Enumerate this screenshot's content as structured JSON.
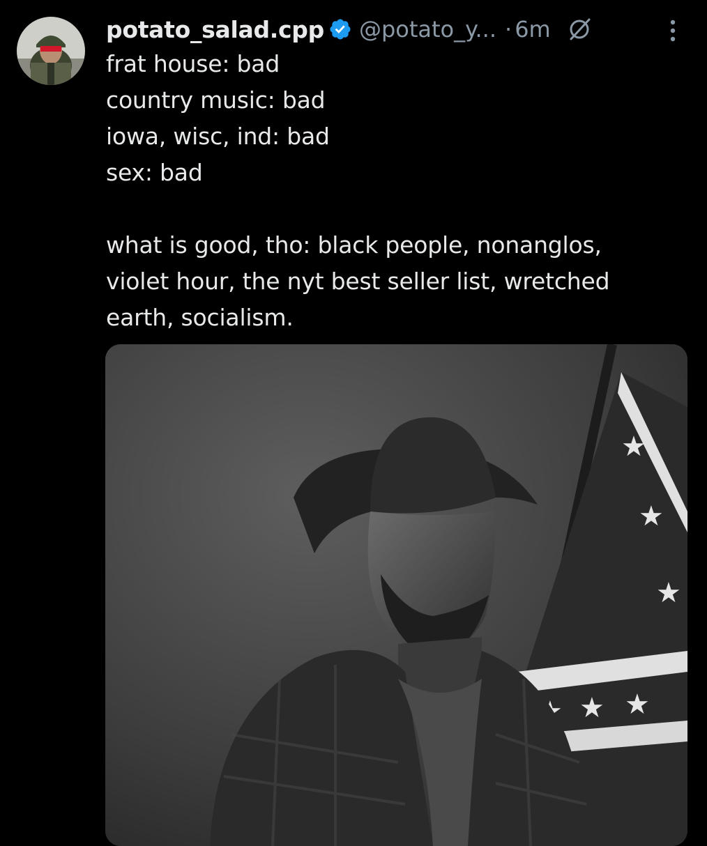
{
  "tweet": {
    "display_name": "potato_salad.cpp",
    "handle": "@potato_y...",
    "separator": "·",
    "time": "6m",
    "lines": [
      "frat house: bad",
      "country music: bad",
      "iowa, wisc, ind: bad",
      "sex: bad"
    ],
    "paragraph2_lines": [
      "what is good, tho: black people, nonanglos,",
      "violet hour, the nyt best seller list, wretched",
      "earth, socialism."
    ]
  },
  "icons": {
    "verified": "verified-badge-icon",
    "grok": "grok-icon",
    "more": "more-vertical-icon"
  },
  "colors": {
    "background": "#000000",
    "text": "#e7e9ea",
    "secondary": "#8b98a5",
    "verified_blue": "#1d9bf0"
  }
}
